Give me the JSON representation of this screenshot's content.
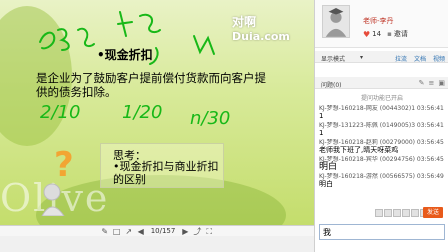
{
  "slide": {
    "logo": {
      "cn": "对啊",
      "en": "Duia.com"
    },
    "title": "•现金折扣",
    "description": "是企业为了鼓励客户提前偿付货款而向客户提供的债务扣除。",
    "think": {
      "title": "思考：",
      "body": "•现金折扣与商业折扣的区别"
    },
    "watermark": "Olive",
    "ink_notes": [
      "2/10",
      "1/20",
      "n/30"
    ]
  },
  "toolbar": {
    "page": "10/157"
  },
  "panel": {
    "teacher_name": "老师-李丹",
    "likes": "14",
    "invite_label": "邀请",
    "mode_label": "显示模式",
    "mode_links": [
      "拉流",
      "文档",
      "视频"
    ],
    "qa_label": "问题(0)",
    "qa_notice": "提问功能已开启",
    "messages": [
      {
        "header": "KJ-梦想-160218-网友 (0044302)1 03:56:41",
        "body": "1",
        "size": "small"
      },
      {
        "header": "KJ-梦想-131223-陈佩 (0149005)3 03:56:41",
        "body": "1",
        "size": "small"
      },
      {
        "header": "KJ-梦想-160218-赵莉 (00279000) 03:56:45",
        "body": "老师我下班了,晴天呀菜鸡",
        "size": "small"
      },
      {
        "header": "KJ-梦想-160218-宾华 (00294756) 03:56:45",
        "body": "明白",
        "size": "big"
      },
      {
        "header": "KJ-梦想-160218-游然 (00566575) 03:56:49",
        "body": "明白",
        "size": "small"
      }
    ],
    "send_label": "发送",
    "input_value": "我"
  }
}
